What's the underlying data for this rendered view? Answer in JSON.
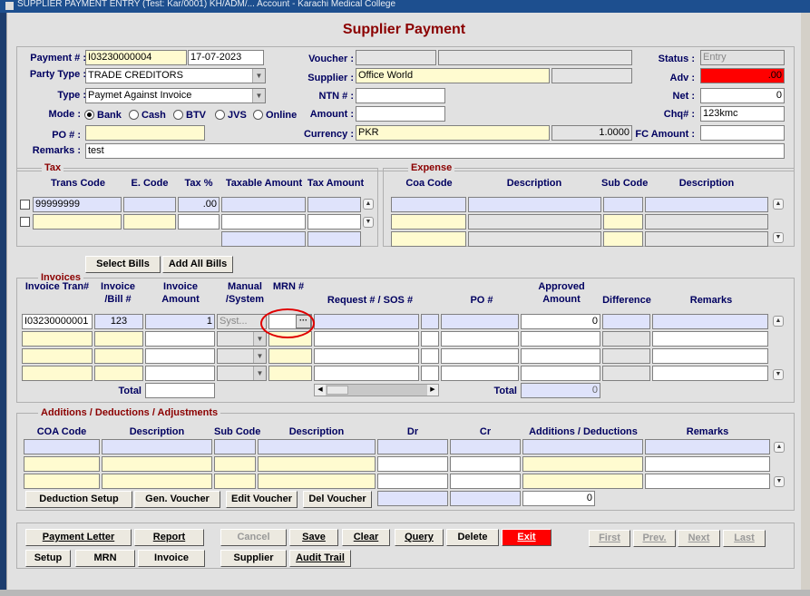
{
  "window": {
    "title": "SUPPLIER PAYMENT ENTRY (Test: Kar/0001) KH/ADM/... Account - Karachi Medical College"
  },
  "form": {
    "title": "Supplier Payment"
  },
  "header": {
    "payment_label": "Payment # :",
    "payment_no": "I03230000004",
    "payment_date": "17-07-2023",
    "party_type_label": "Party Type :",
    "party_type": "TRADE CREDITORS",
    "type_label": "Type :",
    "type": "Paymet Against Invoice",
    "mode_label": "Mode :",
    "mode_options": [
      "Bank",
      "Cash",
      "BTV",
      "JVS",
      "Online"
    ],
    "mode_selected": "Bank",
    "po_label": "PO # :",
    "po": "",
    "remarks_label": "Remarks :",
    "remarks": "test",
    "voucher_label": "Voucher :",
    "voucher": "",
    "voucher2": "",
    "supplier_label": "Supplier :",
    "supplier": "Office World",
    "supplier_code": "",
    "ntn_label": "NTN # :",
    "ntn": "",
    "amount_label": "Amount :",
    "amount": "",
    "currency_label": "Currency :",
    "currency": "PKR",
    "exchange_rate": "1.0000",
    "status_label": "Status :",
    "status": "Entry",
    "adv_label": "Adv :",
    "adv": ".00",
    "net_label": "Net :",
    "net": "0",
    "chq_label": "Chq# :",
    "chq": "123kmc",
    "fc_amount_label": "FC Amount :",
    "fc_amount": ""
  },
  "tax": {
    "title": "Tax",
    "columns": [
      "Trans Code",
      "E. Code",
      "Tax %",
      "Taxable Amount",
      "Tax Amount"
    ],
    "row1": {
      "trans_code": "99999999",
      "e_code": "",
      "tax_pct": ".00",
      "taxable": "",
      "tax_amount": ""
    }
  },
  "expense": {
    "title": "Expense",
    "columns": [
      "Coa Code",
      "Description",
      "Sub Code",
      "Description"
    ]
  },
  "bill_buttons": {
    "select": "Select Bills",
    "add_all": "Add All Bills"
  },
  "invoices": {
    "title": "Invoices",
    "columns": [
      "Invoice Tran#",
      "Invoice /Bill #",
      "Invoice Amount",
      "Manual /System",
      "MRN #",
      "Request # / SOS #",
      "PO #",
      "Approved Amount",
      "Difference",
      "Remarks"
    ],
    "row1": {
      "tran": "I03230000001",
      "bill": "123",
      "amount": "1",
      "system": "Syst...",
      "mrn": "",
      "request": "",
      "po": "",
      "approved": "0",
      "difference": "",
      "remarks": ""
    },
    "total_label": "Total",
    "total": "",
    "total2_label": "Total",
    "total2": "0"
  },
  "adjustments": {
    "title": "Additions / Deductions / Adjustments",
    "columns": [
      "COA Code",
      "Description",
      "Sub Code",
      "Description",
      "Dr",
      "Cr",
      "Additions / Deductions",
      "Remarks"
    ],
    "total": "0",
    "buttons": [
      "Deduction Setup",
      "Gen. Voucher",
      "Edit Voucher",
      "Del Voucher"
    ]
  },
  "footer_buttons": {
    "payment_letter": "Payment Letter",
    "report": "Report",
    "setup": "Setup",
    "mrn": "MRN",
    "invoice": "Invoice",
    "cancel": "Cancel",
    "save": "Save",
    "clear": "Clear",
    "query": "Query",
    "delete": "Delete",
    "exit": "Exit",
    "supplier": "Supplier",
    "audit_trail": "Audit Trail",
    "first": "First",
    "prev": "Prev.",
    "next": "Next",
    "last": "Last"
  },
  "colors": {
    "title": "#8b0000",
    "label": "#000060",
    "yellow_field": "#fffbd0",
    "blue_field": "#dfe3fb",
    "exit": "#ff0000"
  }
}
